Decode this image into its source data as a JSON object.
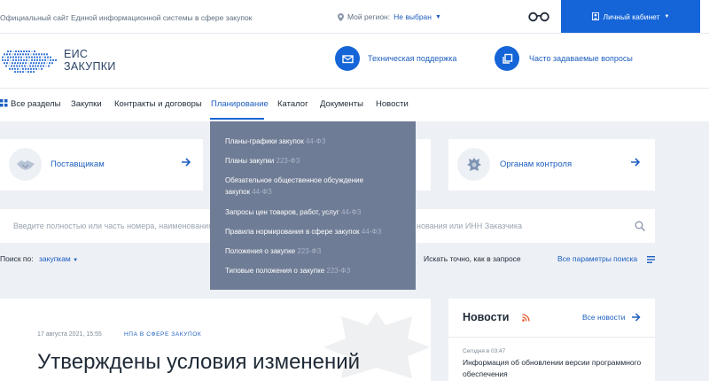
{
  "topbar": {
    "site_text": "Официальный сайт Единой информационной системы в сфере закупок",
    "region_label": "Мой регион:",
    "region_value": "Не выбран",
    "cabinet_label": "Личный кабинет"
  },
  "logo": {
    "line1": "ЕИС",
    "line2": "ЗАКУПКИ"
  },
  "help": {
    "support_label": "Техническая поддержка",
    "faq_label": "Часто задаваемые вопросы"
  },
  "nav": {
    "items": [
      {
        "label": "Все разделы"
      },
      {
        "label": "Закупки"
      },
      {
        "label": "Контракты и договоры"
      },
      {
        "label": "Планирование"
      },
      {
        "label": "Каталог"
      },
      {
        "label": "Документы"
      },
      {
        "label": "Новости"
      }
    ]
  },
  "dropdown": {
    "items": [
      {
        "label": "Планы-графики закупок",
        "law": "44-ФЗ"
      },
      {
        "label": "Планы закупки",
        "law": "223-ФЗ"
      },
      {
        "label": "Обязательное общественное обсуждение",
        "label2": "закупок",
        "law": "44-ФЗ"
      },
      {
        "label": "Запросы цен товаров, работ, услуг",
        "law": "44-ФЗ"
      },
      {
        "label": "Правила нормирования в сфере закупок",
        "law": "44-ФЗ"
      },
      {
        "label": "Положения о закупке",
        "law": "223-ФЗ"
      },
      {
        "label": "Типовые положения о закупке",
        "law": "223-ФЗ"
      }
    ]
  },
  "cards": {
    "suppliers": "Поставщикам",
    "control": "Органам контроля"
  },
  "search": {
    "placeholder_left": "Введите полностью или часть номера, наименования з",
    "placeholder_right": "нования или ИНН Заказчика"
  },
  "filters": {
    "search_by_label": "Поиск по:",
    "search_by_value": "закупкам",
    "exact_label": "Искать точно, как в запросе",
    "all_params": "Все параметры поиска"
  },
  "article": {
    "date": "17 августа 2021, 15:55",
    "tag": "НПА В СФЕРЕ ЗАКУПОК",
    "title": "Утверждены условия изменений"
  },
  "news": {
    "heading": "Новости",
    "all_label": "Все новости",
    "items": [
      {
        "time": "Сегодня в 03:47",
        "title": "Информация об обновлении версии программного обеспечения"
      }
    ]
  },
  "colors": {
    "accent": "#1565d8",
    "dropdown_bg": "#6f7c95",
    "page_bg": "#edf0f5"
  }
}
